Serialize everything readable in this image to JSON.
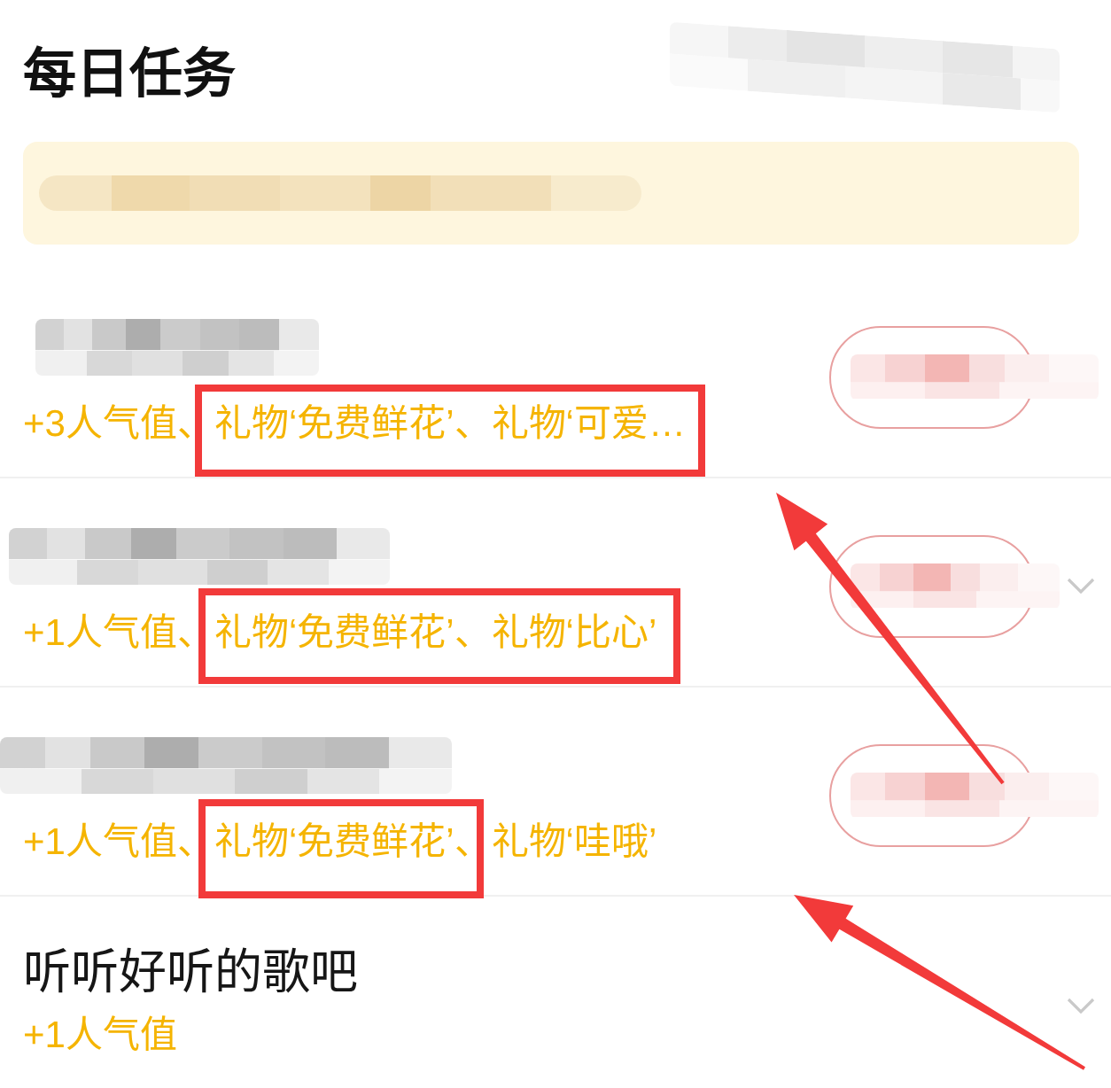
{
  "header": {
    "title": "每日任务",
    "side_redacted": true
  },
  "banner": {
    "redacted": true
  },
  "tasks": [
    {
      "title_redacted": true,
      "reward": "+3人气值、礼物‘免费鲜花’、礼物‘可爱…",
      "button": {
        "redacted": true
      },
      "chevron": false
    },
    {
      "title_redacted": true,
      "reward": "+1人气值、礼物‘免费鲜花’、礼物‘比心’",
      "button": {
        "redacted": true
      },
      "chevron": true
    },
    {
      "title_redacted": true,
      "reward": "+1人气值、礼物‘免费鲜花’、礼物‘哇哦’",
      "button": {
        "redacted": true
      },
      "chevron": false
    },
    {
      "title": "听听好听的歌吧",
      "title_redacted": false,
      "reward": "+1人气值",
      "chevron": true
    }
  ]
}
